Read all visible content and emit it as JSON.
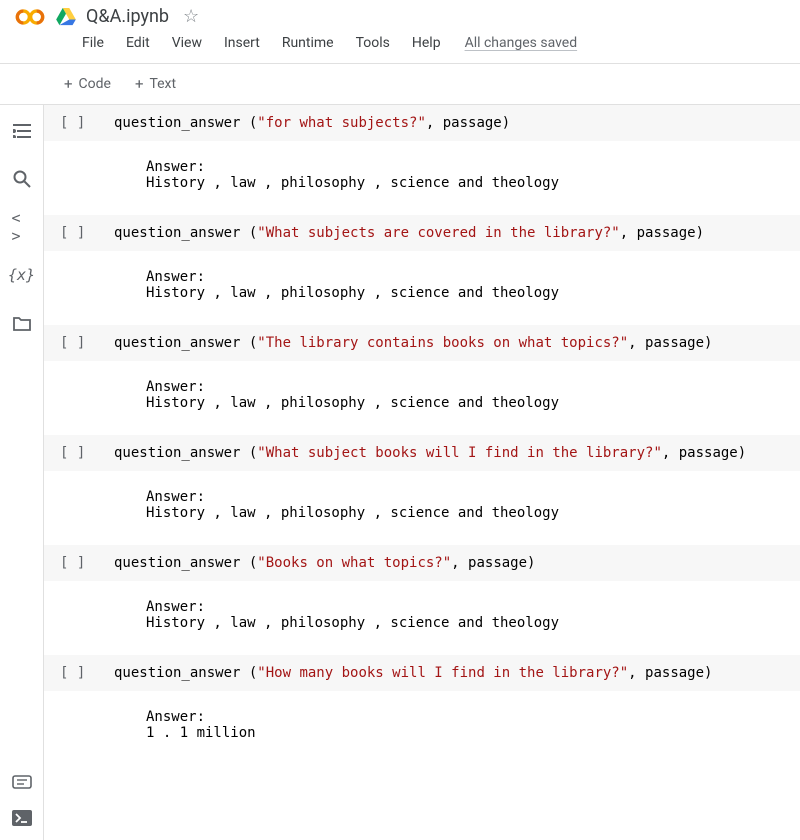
{
  "header": {
    "title": "Q&A.ipynb",
    "status": "All changes saved"
  },
  "menu": {
    "file": "File",
    "edit": "Edit",
    "view": "View",
    "insert": "Insert",
    "runtime": "Runtime",
    "tools": "Tools",
    "help": "Help"
  },
  "toolbar": {
    "code": "Code",
    "text": "Text"
  },
  "cells": [
    {
      "gutter": "[ ]",
      "fn": "question_answer ",
      "str": "\"for what subjects?\"",
      "arg": ", passage)",
      "output": "Answer:\nHistory , law , philosophy , science and theology"
    },
    {
      "gutter": "[ ]",
      "fn": "question_answer ",
      "str": "\"What subjects are covered in the library?\"",
      "arg": ", passage)",
      "output": "Answer:\nHistory , law , philosophy , science and theology"
    },
    {
      "gutter": "[ ]",
      "fn": "question_answer ",
      "str": "\"The library contains books on what topics?\"",
      "arg": ", passage)",
      "output": "Answer:\nHistory , law , philosophy , science and theology"
    },
    {
      "gutter": "[ ]",
      "fn": "question_answer ",
      "str": "\"What subject books will I find in the library?\"",
      "arg": ", passage)",
      "output": "Answer:\nHistory , law , philosophy , science and theology"
    },
    {
      "gutter": "[ ]",
      "fn": "question_answer ",
      "str": "\"Books on what topics?\"",
      "arg": ", passage)",
      "output": "Answer:\nHistory , law , philosophy , science and theology"
    },
    {
      "gutter": "[ ]",
      "fn": "question_answer ",
      "str": "\"How many books will I find in the library?\"",
      "arg": ", passage)",
      "output": "Answer:\n1 . 1 million"
    }
  ]
}
